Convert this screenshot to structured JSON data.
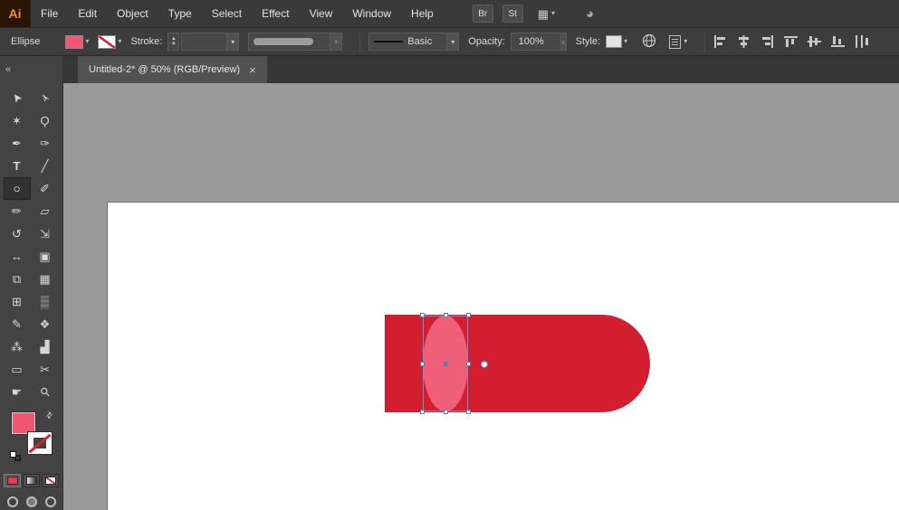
{
  "colors": {
    "menubar_bg": "#3a3a3a",
    "controlbar_bg": "#3d3d3d",
    "panel_bg": "#434343",
    "canvas_bg": "#9a9a9a",
    "artboard": "#ffffff",
    "shape_red": "#d21e2f",
    "shape_pink": "#ef5f78",
    "fill_swatch_pink": "#f25672",
    "selection_blue": "#4f82c4",
    "logo_orange": "#ff8a1f"
  },
  "menubar": {
    "logo": "Ai",
    "items": [
      "File",
      "Edit",
      "Object",
      "Type",
      "Select",
      "Effect",
      "View",
      "Window",
      "Help"
    ],
    "bridge_label": "Br",
    "stock_label": "St"
  },
  "controlbar": {
    "tool_label": "Ellipse",
    "stroke_label": "Stroke:",
    "stroke_weight_value": "",
    "line_style_value": "Basic",
    "opacity_label": "Opacity:",
    "opacity_value": "100%",
    "style_label": "Style:"
  },
  "tabbar": {
    "collapse_glyph": "«",
    "tab_title": "Untitled-2* @ 50% (RGB/Preview)",
    "close_glyph": "×"
  },
  "icons": {
    "caret": "▾",
    "stepper_up": "▲",
    "stepper_down": "▼",
    "opacity_arrow": "›",
    "workspace": "▦",
    "sync": "◕",
    "swap": "⇄",
    "globe": "globe-svg",
    "align_set": [
      "horizontal-align-left",
      "horizontal-align-center",
      "horizontal-align-right",
      "vertical-align-top",
      "vertical-align-middle",
      "vertical-align-bottom"
    ]
  },
  "tools": [
    {
      "name": "selection",
      "glyph": "➤"
    },
    {
      "name": "direct-selection",
      "glyph": "➢"
    },
    {
      "name": "magic-wand",
      "glyph": "✶"
    },
    {
      "name": "lasso",
      "glyph": "Ϙ"
    },
    {
      "name": "pen",
      "glyph": "✒"
    },
    {
      "name": "curvature",
      "glyph": "✑"
    },
    {
      "name": "type",
      "glyph": "T"
    },
    {
      "name": "line-segment",
      "glyph": "╱"
    },
    {
      "name": "ellipse",
      "glyph": "○"
    },
    {
      "name": "paintbrush",
      "glyph": "✐"
    },
    {
      "name": "pencil",
      "glyph": "✏"
    },
    {
      "name": "eraser",
      "glyph": "▱"
    },
    {
      "name": "rotate",
      "glyph": "↺"
    },
    {
      "name": "scale",
      "glyph": "⇲"
    },
    {
      "name": "width",
      "glyph": "↔"
    },
    {
      "name": "free-transform",
      "glyph": "▣"
    },
    {
      "name": "shape-builder",
      "glyph": "⧉"
    },
    {
      "name": "perspective-grid",
      "glyph": "▦"
    },
    {
      "name": "mesh",
      "glyph": "⊞"
    },
    {
      "name": "gradient",
      "glyph": "▒"
    },
    {
      "name": "eyedropper",
      "glyph": "✎"
    },
    {
      "name": "blend",
      "glyph": "❖"
    },
    {
      "name": "symbol-sprayer",
      "glyph": "⁂"
    },
    {
      "name": "column-graph",
      "glyph": "▟"
    },
    {
      "name": "artboard",
      "glyph": "▭"
    },
    {
      "name": "slice",
      "glyph": "✂"
    },
    {
      "name": "hand",
      "glyph": "☛"
    },
    {
      "name": "zoom",
      "glyph": "⚲"
    }
  ],
  "document": {
    "zoom_level": "50%",
    "color_mode": "RGB/Preview",
    "active_tool": "Ellipse"
  }
}
